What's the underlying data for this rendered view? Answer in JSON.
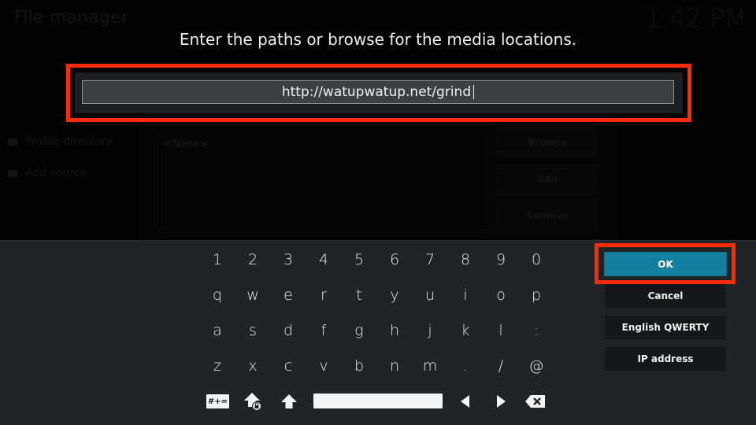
{
  "background": {
    "window_title": "File manager",
    "clock": "1:42 PM",
    "sidebar": [
      {
        "label": "Profile directory",
        "icon": "folder-icon"
      },
      {
        "label": "Add source",
        "icon": "folder-icon"
      }
    ],
    "list_placeholder": "<None>",
    "buttons": [
      "Browse",
      "Add",
      "Remove"
    ]
  },
  "dialog": {
    "heading": "Enter the paths or browse for the media locations.",
    "input_value": "http://watupwatup.net/grind",
    "highlight_color": "#ff2a00"
  },
  "keyboard": {
    "rows": [
      [
        "1",
        "2",
        "3",
        "4",
        "5",
        "6",
        "7",
        "8",
        "9",
        "0"
      ],
      [
        "q",
        "w",
        "e",
        "r",
        "t",
        "y",
        "u",
        "i",
        "o",
        "p"
      ],
      [
        "a",
        "s",
        "d",
        "f",
        "g",
        "h",
        "j",
        "k",
        "l",
        ":"
      ],
      [
        "z",
        "x",
        "c",
        "v",
        "b",
        "n",
        "m",
        ".",
        "/",
        "@"
      ]
    ],
    "symbols_label": "#+=",
    "bottom_icons": [
      "symbols-key-icon",
      "caps-lock-icon",
      "shift-icon",
      "space-bar",
      "cursor-left-icon",
      "cursor-right-icon",
      "backspace-icon"
    ]
  },
  "actions": {
    "ok": "OK",
    "cancel": "Cancel",
    "layout": "English QWERTY",
    "ip": "IP address",
    "ok_color": "#12809f"
  }
}
